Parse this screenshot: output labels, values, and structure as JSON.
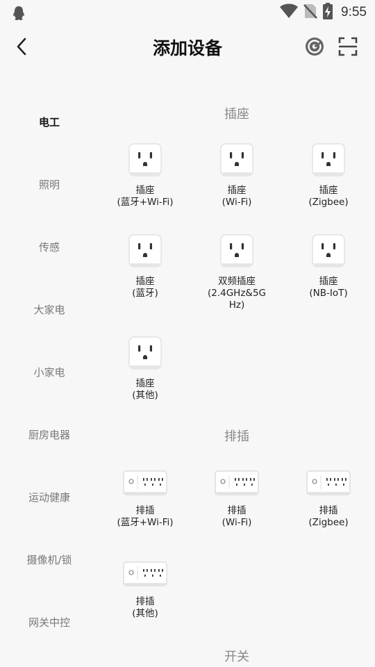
{
  "status_bar": {
    "time": "9:55"
  },
  "header": {
    "title": "添加设备"
  },
  "sidebar": {
    "items": [
      {
        "label": "电工",
        "active": true
      },
      {
        "label": "照明"
      },
      {
        "label": "传感"
      },
      {
        "label": "大家电"
      },
      {
        "label": "小家电"
      },
      {
        "label": "厨房电器"
      },
      {
        "label": "运动健康"
      },
      {
        "label": "摄像机/锁"
      },
      {
        "label": "网关中控"
      }
    ]
  },
  "sections": [
    {
      "title": "插座",
      "devices": [
        {
          "name": "插座",
          "sub": "(蓝牙+Wi-Fi)",
          "icon": "outlet-icon"
        },
        {
          "name": "插座",
          "sub": "(Wi-Fi)",
          "icon": "outlet-icon"
        },
        {
          "name": "插座",
          "sub": "(Zigbee)",
          "icon": "outlet-icon"
        },
        {
          "name": "插座",
          "sub": "(蓝牙)",
          "icon": "outlet-icon"
        },
        {
          "name": "双频插座",
          "sub": "(2.4GHz&5GHz)",
          "icon": "outlet-icon"
        },
        {
          "name": "插座",
          "sub": "(NB-IoT)",
          "icon": "outlet-icon"
        },
        {
          "name": "插座",
          "sub": "(其他)",
          "icon": "outlet-icon"
        }
      ]
    },
    {
      "title": "排插",
      "devices": [
        {
          "name": "排插",
          "sub": "(蓝牙+Wi-Fi)",
          "icon": "power-strip-icon"
        },
        {
          "name": "排插",
          "sub": "(Wi-Fi)",
          "icon": "power-strip-icon"
        },
        {
          "name": "排插",
          "sub": "(Zigbee)",
          "icon": "power-strip-icon"
        },
        {
          "name": "排插",
          "sub": "(其他)",
          "icon": "power-strip-icon"
        }
      ]
    },
    {
      "title": "开关",
      "devices": []
    }
  ]
}
